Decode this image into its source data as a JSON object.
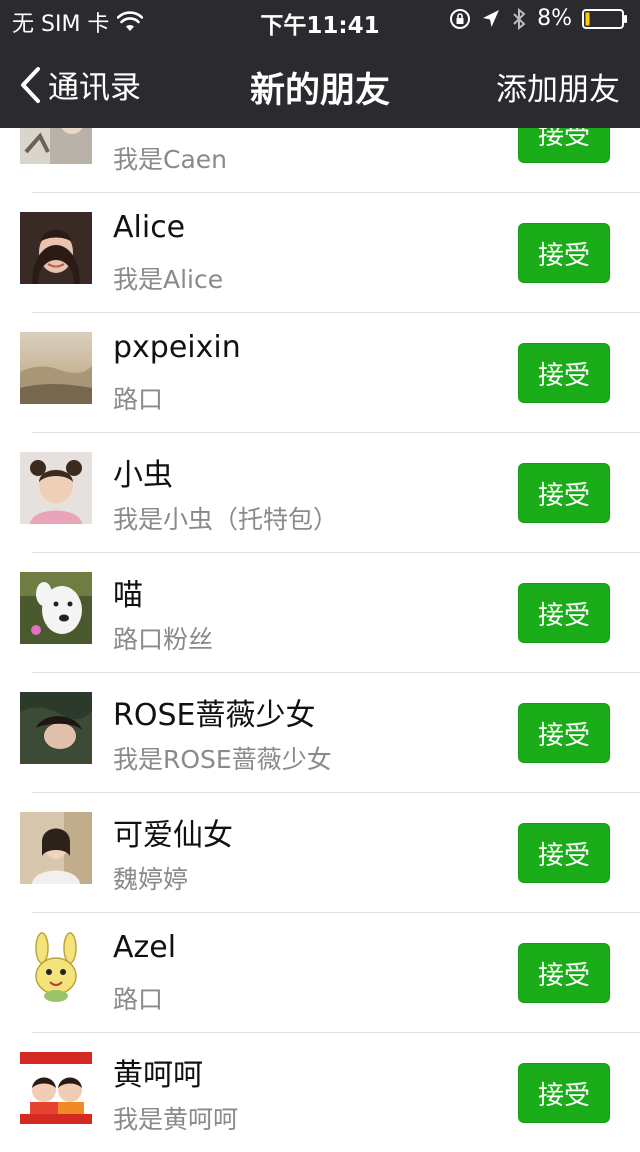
{
  "status_bar": {
    "carrier": "无 SIM 卡",
    "time": "下午11:41",
    "battery": "8%"
  },
  "nav": {
    "back_label": "通讯录",
    "title": "新的朋友",
    "action_label": "添加朋友"
  },
  "colors": {
    "header_bg": "#2b2b2f",
    "accept_green": "#1aad19"
  },
  "requests": [
    {
      "name": "",
      "message": "我是Caen",
      "button": "接受"
    },
    {
      "name": "Alice",
      "message": "我是Alice",
      "button": "接受"
    },
    {
      "name": "pxpeixin",
      "message": "路口",
      "button": "接受"
    },
    {
      "name": "小虫",
      "message": "我是小虫（托特包）",
      "button": "接受"
    },
    {
      "name": "喵",
      "message": "路口粉丝",
      "button": "接受"
    },
    {
      "name": "ROSE蔷薇少女",
      "message": "我是ROSE蔷薇少女",
      "button": "接受"
    },
    {
      "name": "可爱仙女",
      "message": "魏婷婷",
      "button": "接受"
    },
    {
      "name": "Azel",
      "message": "路口",
      "button": "接受"
    },
    {
      "name": "黄呵呵",
      "message": "我是黄呵呵",
      "button": "接受"
    }
  ]
}
